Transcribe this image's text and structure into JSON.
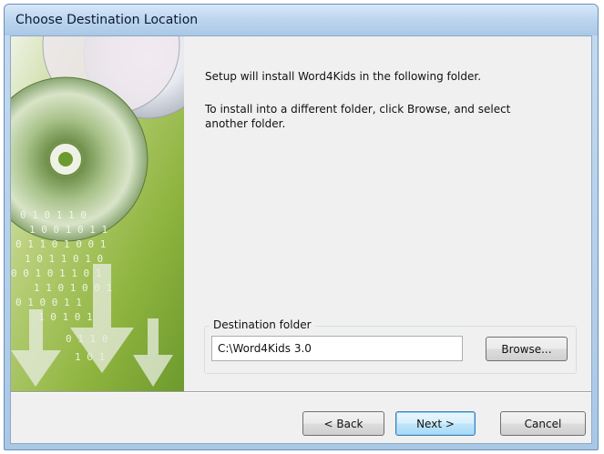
{
  "window": {
    "title": "Choose Destination Location"
  },
  "content": {
    "line1": "Setup will install Word4Kids in the following folder.",
    "line2": "To install into a different folder, click Browse, and select another folder."
  },
  "destination": {
    "group_label": "Destination folder",
    "path": "C:\\Word4Kids 3.0",
    "browse_label": "Browse..."
  },
  "buttons": {
    "back": "< Back",
    "next": "Next >",
    "cancel": "Cancel"
  },
  "colors": {
    "banner_green": "#7fae3a",
    "default_button_border": "#3c7fb1"
  }
}
